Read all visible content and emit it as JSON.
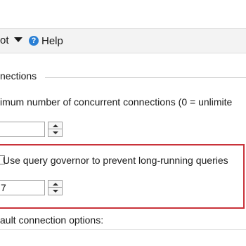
{
  "toolbar": {
    "script_label": "ot",
    "help_label": "Help",
    "help_icon": "help-circle-icon"
  },
  "connections": {
    "section_title": "nections",
    "max_concurrent_label": "imum number of concurrent connections (0 = unlimite",
    "max_concurrent_value": ""
  },
  "governor": {
    "checkbox_label": "Use query governor to prevent long-running queries",
    "value": "7",
    "checked": false
  },
  "default_options_label": "ault connection options:",
  "colors": {
    "highlight": "#c9323a",
    "help_icon": "#2a7fd4"
  }
}
